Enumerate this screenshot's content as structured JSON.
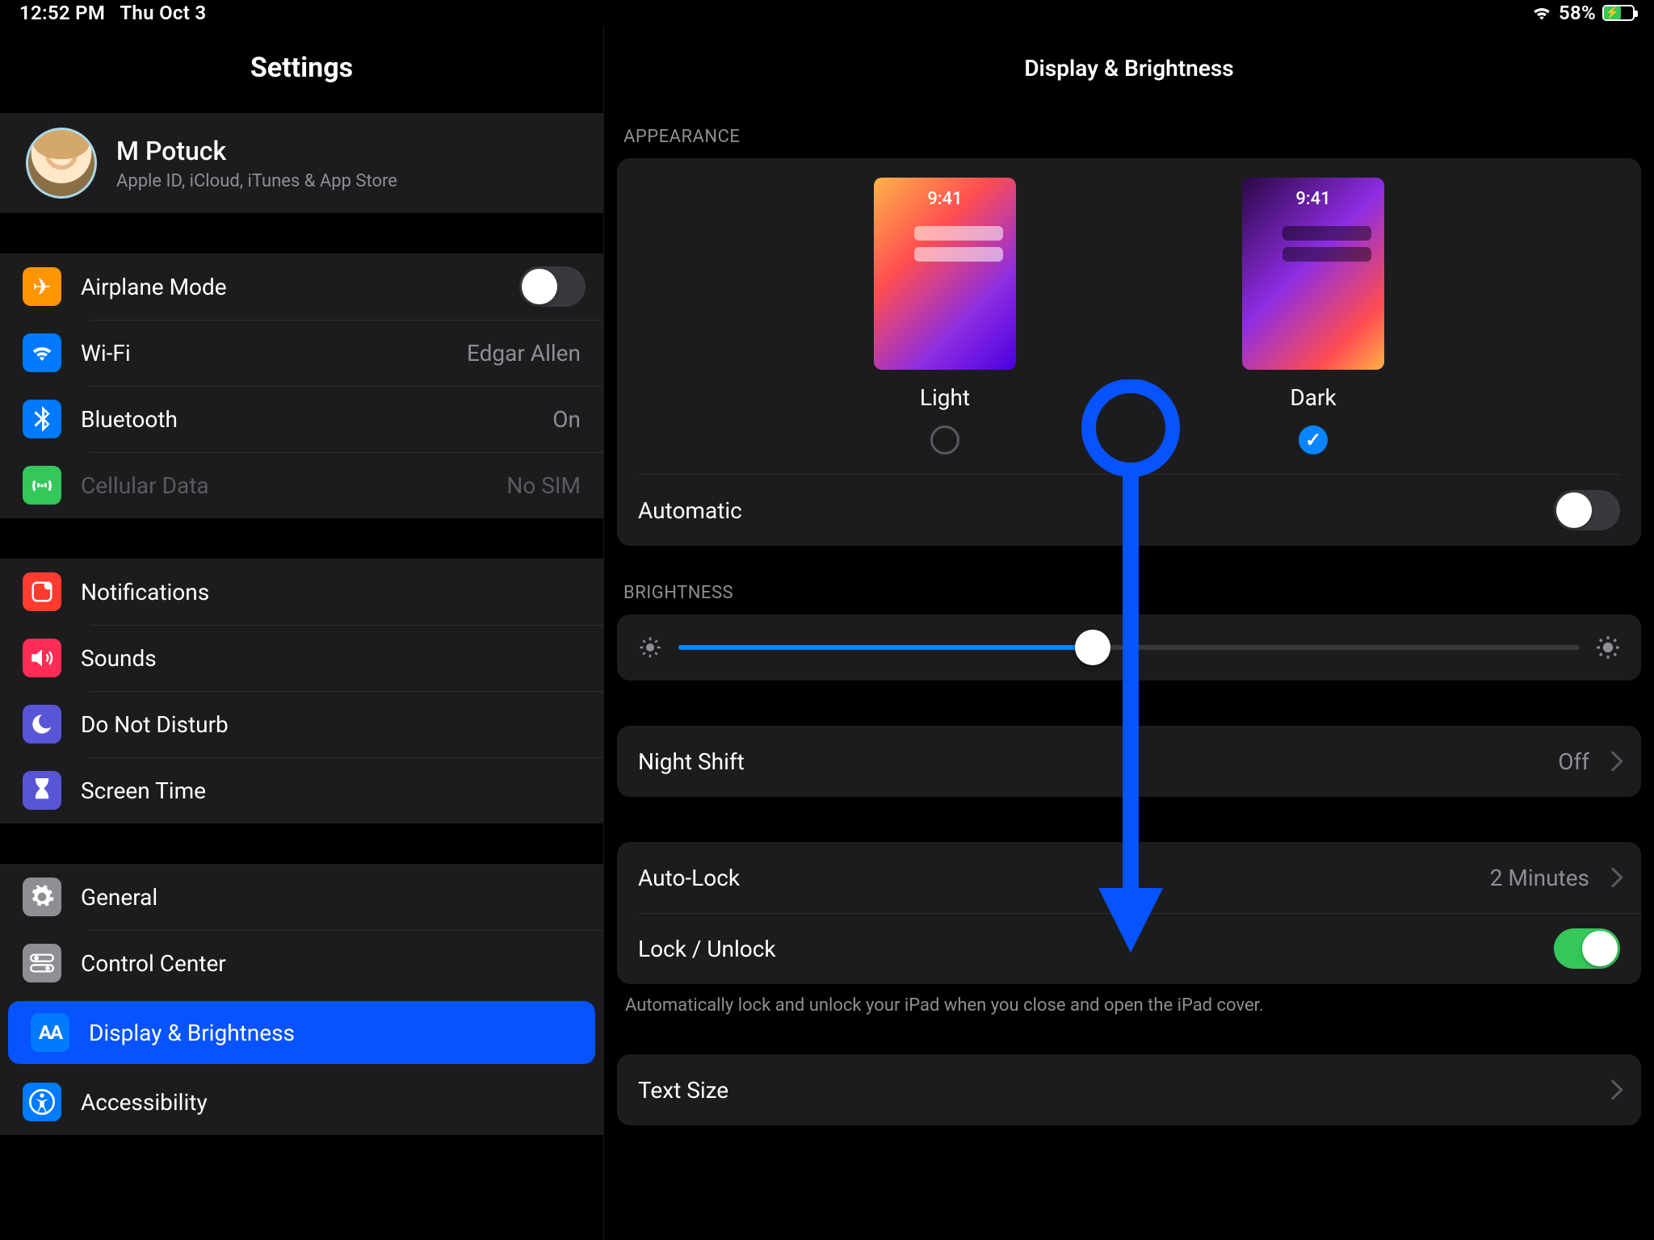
{
  "status": {
    "time": "12:52 PM",
    "date": "Thu Oct 3",
    "battery": "58%"
  },
  "sidebar": {
    "title": "Settings",
    "profile": {
      "name": "M Potuck",
      "subtitle": "Apple ID, iCloud, iTunes & App Store"
    },
    "g1": [
      {
        "label": "Airplane Mode"
      },
      {
        "label": "Wi-Fi",
        "value": "Edgar Allen"
      },
      {
        "label": "Bluetooth",
        "value": "On"
      },
      {
        "label": "Cellular Data",
        "value": "No SIM"
      }
    ],
    "g2": [
      {
        "label": "Notifications"
      },
      {
        "label": "Sounds"
      },
      {
        "label": "Do Not Disturb"
      },
      {
        "label": "Screen Time"
      }
    ],
    "g3": [
      {
        "label": "General"
      },
      {
        "label": "Control Center"
      },
      {
        "label": "Display & Brightness"
      },
      {
        "label": "Accessibility"
      }
    ]
  },
  "main": {
    "title": "Display & Brightness",
    "appearance_header": "APPEARANCE",
    "light_label": "Light",
    "dark_label": "Dark",
    "automatic": "Automatic",
    "brightness_header": "BRIGHTNESS",
    "nightshift": {
      "label": "Night Shift",
      "value": "Off"
    },
    "autolock": {
      "label": "Auto-Lock",
      "value": "2 Minutes"
    },
    "lockunlock": "Lock / Unlock",
    "lock_footer": "Automatically lock and unlock your iPad when you close and open the iPad cover.",
    "textsize": "Text Size"
  }
}
